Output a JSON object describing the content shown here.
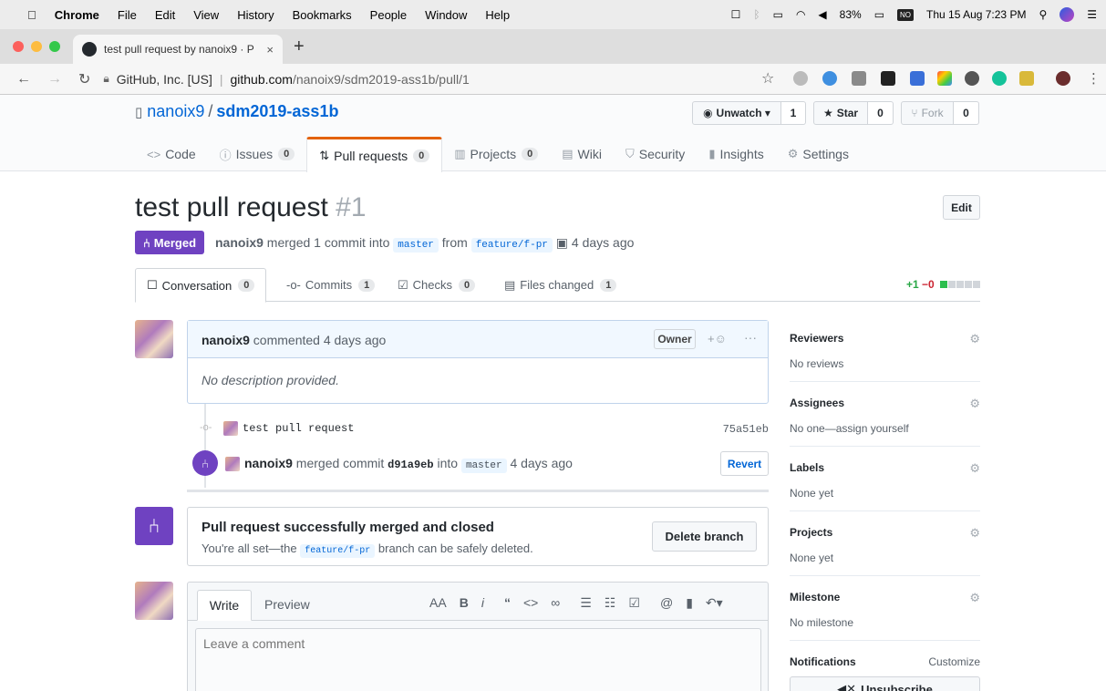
{
  "menubar": {
    "apple": "",
    "app": "Chrome",
    "items": [
      "File",
      "Edit",
      "View",
      "History",
      "Bookmarks",
      "People",
      "Window",
      "Help"
    ],
    "battery": "83%",
    "clock": "Thu 15 Aug  7:23 PM"
  },
  "browser": {
    "tab_title": "test pull request by nanoix9 · P",
    "tab_close": "×",
    "new_tab": "+",
    "org": "GitHub, Inc. [US]",
    "url_host": "github.com",
    "url_path": "/nanoix9/sdm2019-ass1b/pull/1"
  },
  "repo": {
    "owner": "nanoix9",
    "name": "sdm2019-ass1b",
    "unwatch": "Unwatch ▾",
    "watch_count": "1",
    "star": "Star",
    "star_count": "0",
    "fork": "Fork",
    "fork_count": "0",
    "nav": [
      {
        "icon": "<>",
        "label": "Code",
        "count": ""
      },
      {
        "icon": "ⓘ",
        "label": "Issues",
        "count": "0"
      },
      {
        "icon": "⇅",
        "label": "Pull requests",
        "count": "0"
      },
      {
        "icon": "▥",
        "label": "Projects",
        "count": "0"
      },
      {
        "icon": "▤",
        "label": "Wiki",
        "count": ""
      },
      {
        "icon": "⛉",
        "label": "Security",
        "count": ""
      },
      {
        "icon": "▮",
        "label": "Insights",
        "count": ""
      },
      {
        "icon": "⚙",
        "label": "Settings",
        "count": ""
      }
    ]
  },
  "pr": {
    "title": "test pull request",
    "number": "#1",
    "edit": "Edit",
    "state": "Merged",
    "author": "nanoix9",
    "merged_text": "merged 1 commit into",
    "base": "master",
    "from": "from",
    "head": "feature/f-pr",
    "ago": "4 days ago",
    "tabs": [
      {
        "label": "Conversation",
        "count": "0"
      },
      {
        "label": "Commits",
        "count": "1"
      },
      {
        "label": "Checks",
        "count": "0"
      },
      {
        "label": "Files changed",
        "count": "1"
      }
    ],
    "additions": "+1",
    "deletions": "−0"
  },
  "comment": {
    "author": "nanoix9",
    "action": "commented 4 days ago",
    "badge": "Owner",
    "body": "No description provided."
  },
  "timeline": {
    "commit_msg": "test pull request",
    "commit_sha": "75a51eb",
    "merge_author": "nanoix9",
    "merge_text": "merged commit",
    "merge_sha": "d91a9eb",
    "into": "into",
    "merge_base": "master",
    "merge_ago": "4 days ago",
    "revert": "Revert"
  },
  "mergebox": {
    "heading": "Pull request successfully merged and closed",
    "desc_pre": "You're all set—the",
    "branch": "feature/f-pr",
    "desc_post": "branch can be safely deleted.",
    "delete": "Delete branch"
  },
  "newcomment": {
    "write": "Write",
    "preview": "Preview",
    "placeholder": "Leave a comment"
  },
  "sidebar": {
    "reviewers": "Reviewers",
    "reviewers_val": "No reviews",
    "assignees": "Assignees",
    "assignees_val": "No one—assign yourself",
    "labels": "Labels",
    "labels_val": "None yet",
    "projects": "Projects",
    "projects_val": "None yet",
    "milestone": "Milestone",
    "milestone_val": "No milestone",
    "notifications": "Notifications",
    "customize": "Customize",
    "unsubscribe": "Unsubscribe"
  }
}
